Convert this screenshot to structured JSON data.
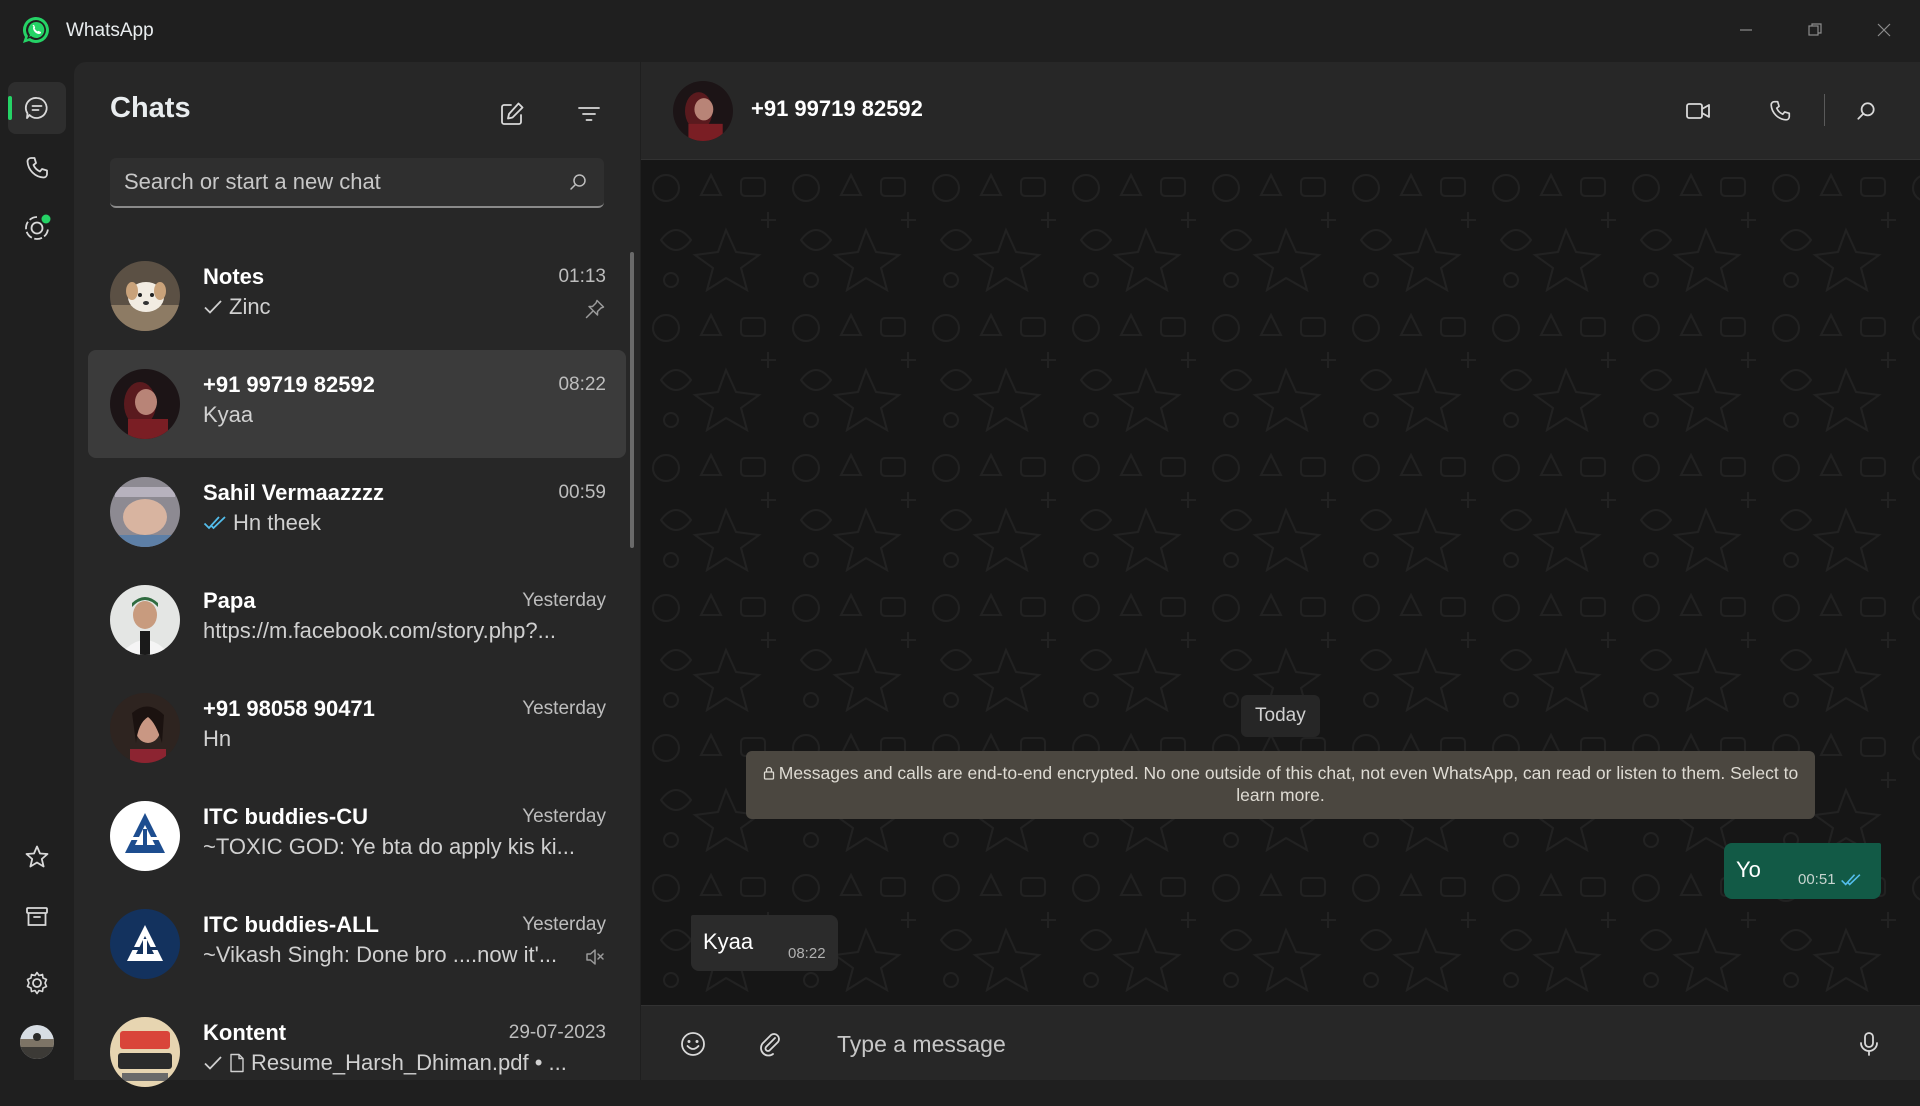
{
  "app": {
    "title": "WhatsApp",
    "brand_color": "#25d366"
  },
  "window_controls": {
    "minimize": "minimize-icon",
    "restore": "restore-icon",
    "close": "close-icon"
  },
  "rail": {
    "top": [
      "chat-icon",
      "phone-icon",
      "status-icon"
    ],
    "bottom": [
      "star-icon",
      "archive-icon",
      "gear-icon",
      "avatar"
    ],
    "active": "chat-icon"
  },
  "panel": {
    "title": "Chats",
    "search_placeholder": "Search or start a new chat",
    "chats": [
      {
        "name": "Notes",
        "time": "01:13",
        "preview": "Zinc",
        "tick": "single",
        "aux": "pin-icon",
        "avatar_color": "#d9c9b6"
      },
      {
        "name": "+91 99719 82592",
        "time": "08:22",
        "preview": "Kyaa",
        "tick": "",
        "aux": "",
        "selected": true,
        "avatar_color": "#4a1c22"
      },
      {
        "name": "Sahil Vermaazzzz",
        "time": "00:59",
        "preview": "Hn theek",
        "tick": "double-blue",
        "aux": "",
        "avatar_color": "#8d8a92"
      },
      {
        "name": "Papa",
        "time": "Yesterday",
        "preview": "https://m.facebook.com/story.php?...",
        "tick": "",
        "aux": "",
        "avatar_color": "#d8dcd8"
      },
      {
        "name": "+91 98058 90471",
        "time": "Yesterday",
        "preview": "Hn",
        "tick": "",
        "aux": "",
        "avatar_color": "#3a241c"
      },
      {
        "name": "ITC buddies-CU",
        "time": "Yesterday",
        "preview": "~TOXIC GOD: Ye bta do apply kis ki...",
        "tick": "",
        "aux": "",
        "avatar_color": "#ffffff"
      },
      {
        "name": "ITC buddies-ALL",
        "time": "Yesterday",
        "preview": "~Vikash Singh: Done bro ....now it'...",
        "tick": "",
        "aux": "mute-icon",
        "avatar_color": "#13325e"
      },
      {
        "name": "Kontent",
        "time": "29-07-2023",
        "preview": "Resume_Harsh_Dhiman.pdf • ...",
        "tick": "single",
        "aux": "",
        "doc": true,
        "avatar_color": "#e7d5b1"
      }
    ]
  },
  "conversation": {
    "contact_name": "+91 99719 82592",
    "date_chip": "Today",
    "encryption_notice": "Messages and calls are end-to-end encrypted. No one outside of this chat, not even WhatsApp, can read or listen to them. Select to learn more.",
    "messages": [
      {
        "direction": "out",
        "text": "Yo",
        "time": "00:51",
        "status": "read"
      },
      {
        "direction": "in",
        "text": "Kyaa",
        "time": "08:22"
      }
    ],
    "header_actions": [
      "video-call-icon",
      "voice-call-icon",
      "search-icon"
    ],
    "composer": {
      "placeholder": "Type a message",
      "actions": [
        "emoji-icon",
        "attach-icon",
        "mic-icon"
      ]
    }
  }
}
